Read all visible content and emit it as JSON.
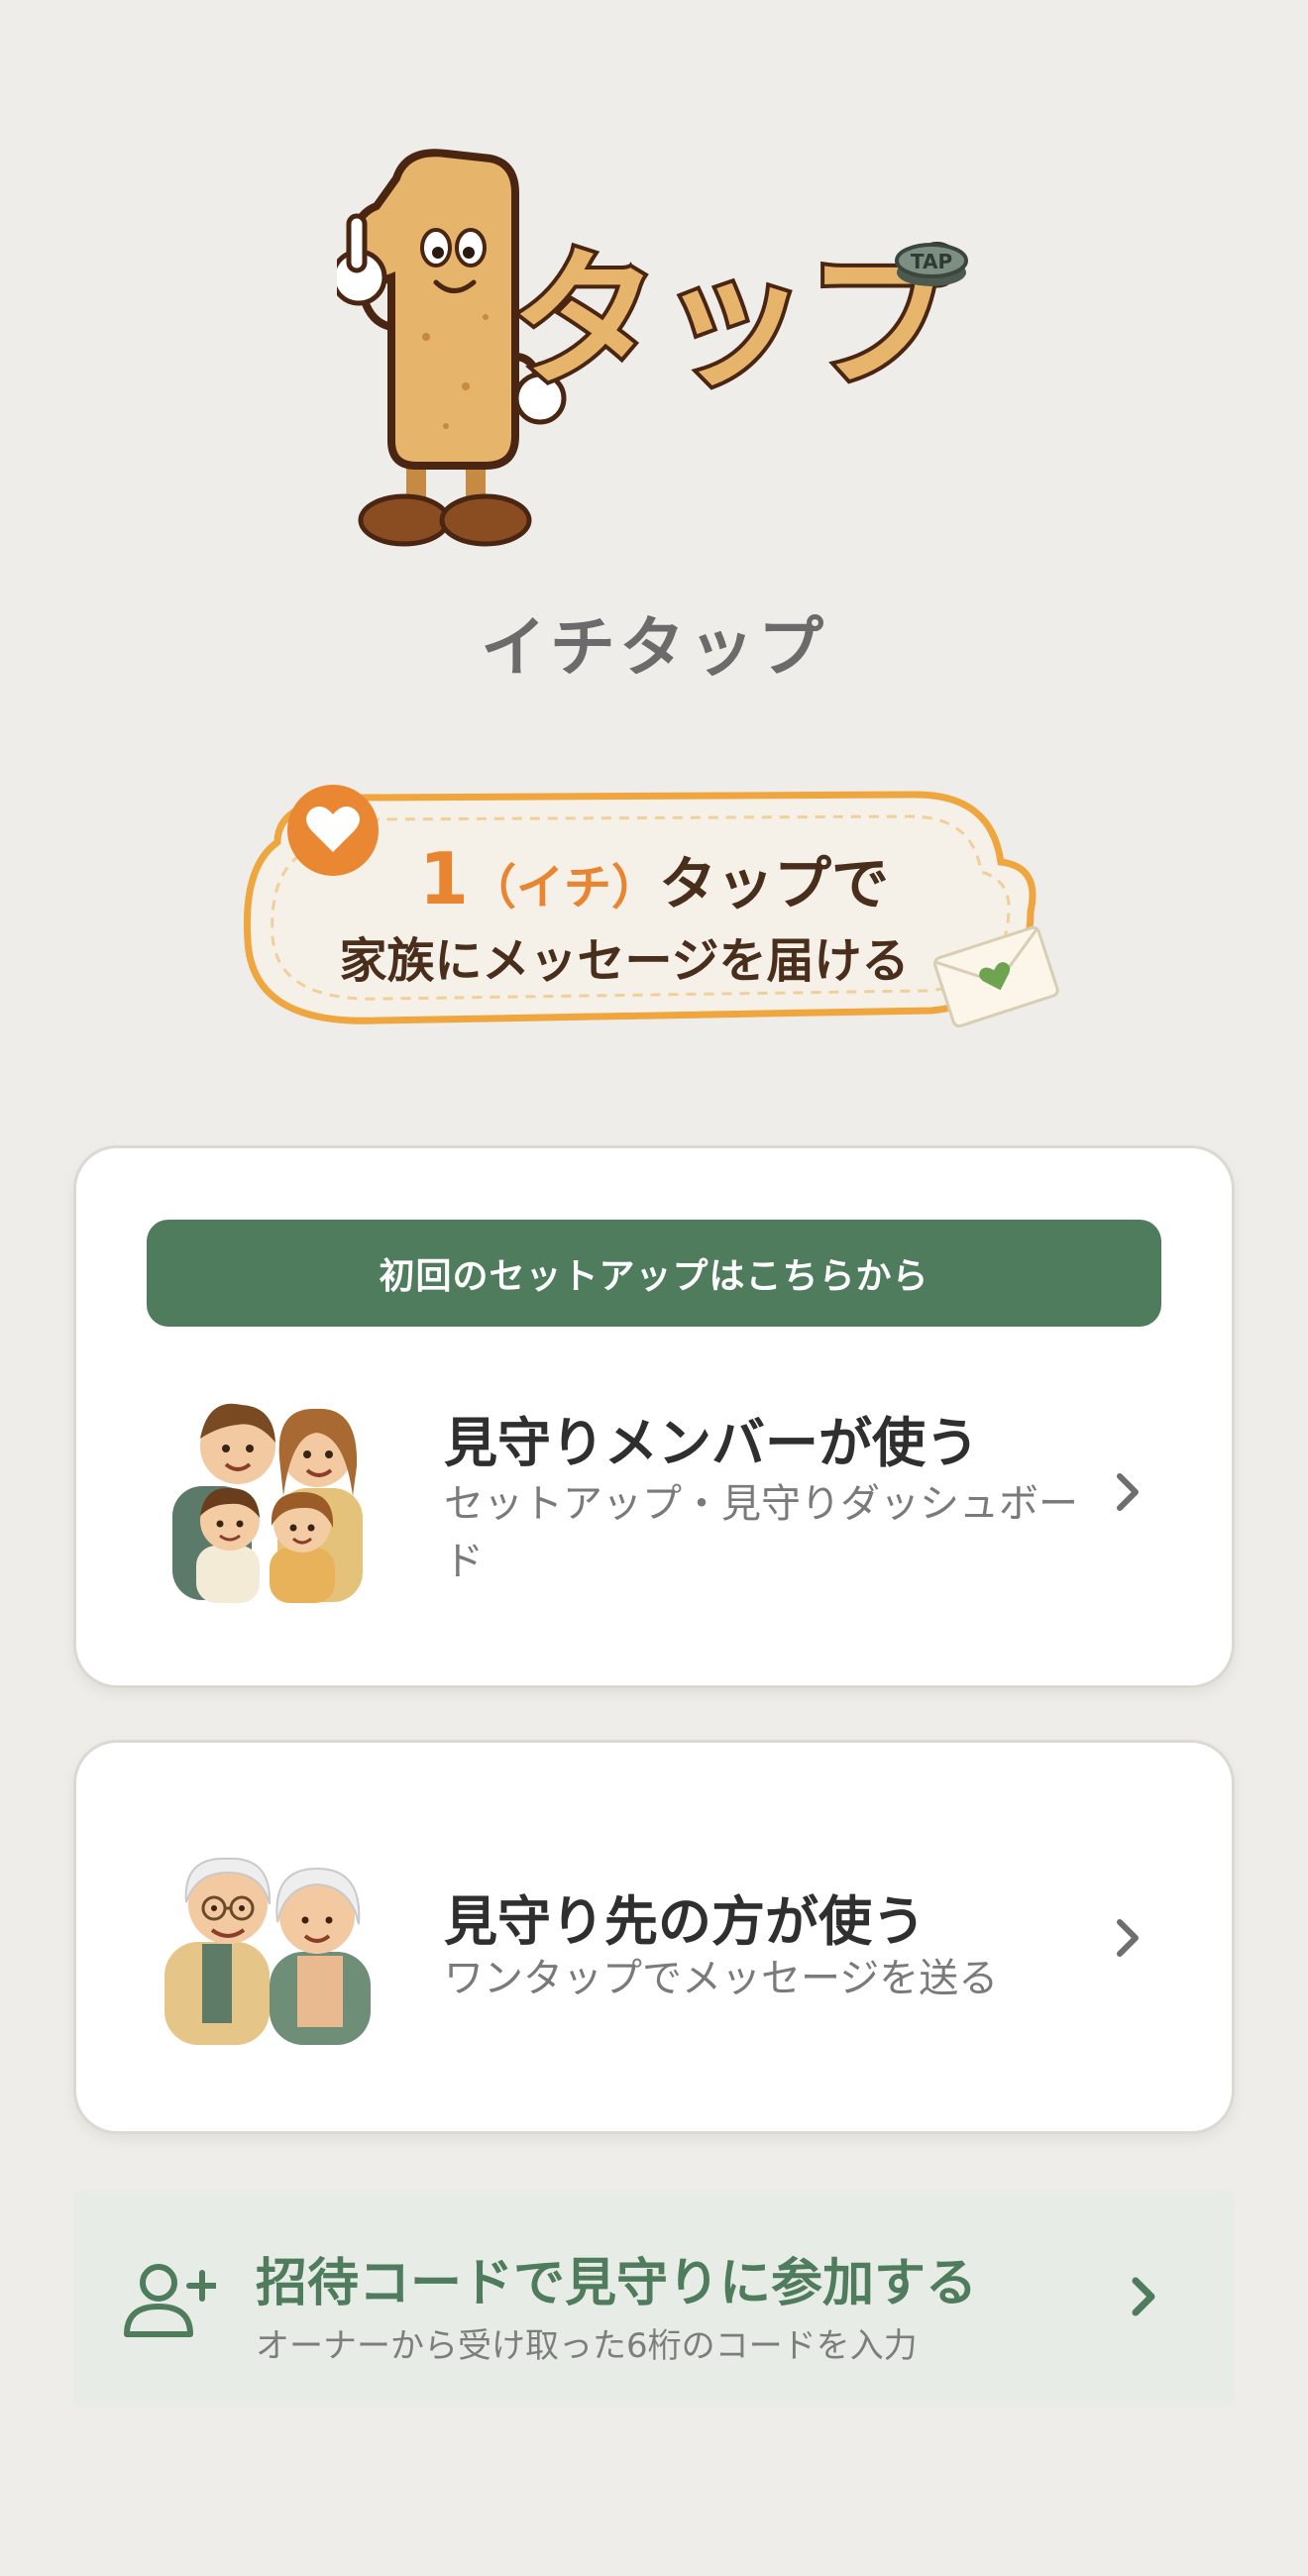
{
  "app": {
    "logo_wordmark": "タップ",
    "logo_button_text": "TAP",
    "name": "イチタップ"
  },
  "tagline": {
    "number": "1",
    "reading": "（イチ）",
    "line1_rest": "タップで",
    "line2": "家族にメッセージを届ける"
  },
  "member_card": {
    "banner": "初回のセットアップはこちらから",
    "title": "見守りメンバーが使う",
    "subtitle": "セットアップ・見守りダッシュボード"
  },
  "elder_card": {
    "title": "見守り先の方が使う",
    "subtitle": "ワンタップでメッセージを送る"
  },
  "invite": {
    "title": "招待コードで見守りに参加する",
    "subtitle": "オーナーから受け取った6桁のコードを入力"
  },
  "colors": {
    "background": "#eeedea",
    "accent_green": "#4f7c5c",
    "accent_orange": "#e98530",
    "text_dark": "#2f2f2f",
    "text_muted": "#7a7a7a"
  },
  "icons": {
    "member_card_illustration": "family-illustration",
    "elder_card_illustration": "elderly-couple-illustration",
    "invite_icon": "add-user-icon",
    "tagline_icon": "heart-icon",
    "tagline_decoration": "envelope-icon",
    "chevron": "chevron-right-icon"
  }
}
